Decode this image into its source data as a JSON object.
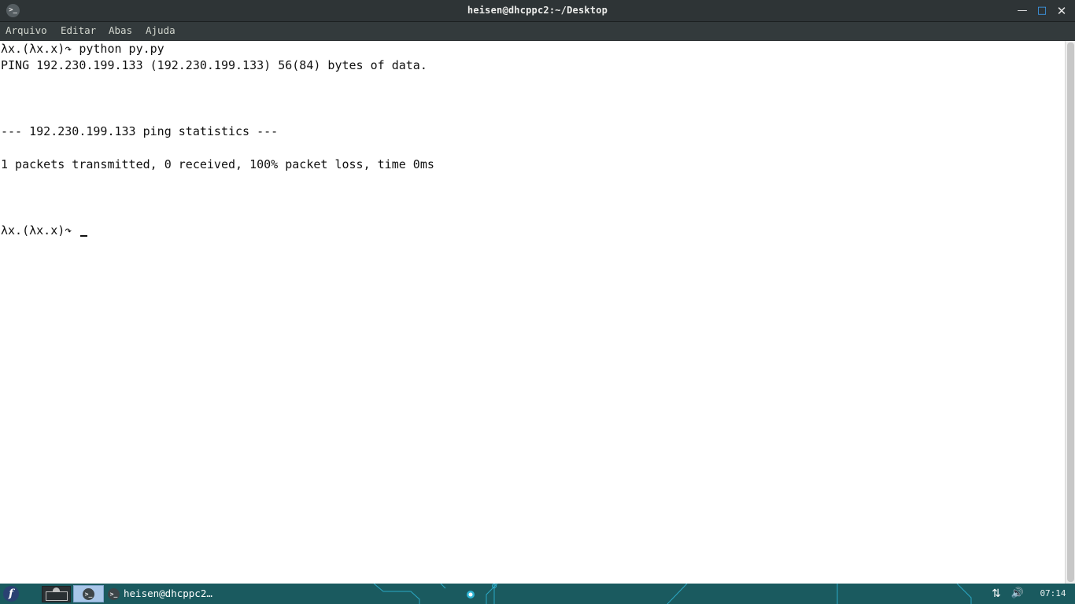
{
  "window": {
    "title": "heisen@dhcppc2:~/Desktop",
    "app_icon_glyph": ">_",
    "controls": {
      "minimize": "—",
      "maximize": "□",
      "close": "✕"
    }
  },
  "menu": {
    "items": [
      "Arquivo",
      "Editar",
      "Abas",
      "Ajuda"
    ]
  },
  "terminal": {
    "prompt": "λx.(λx.x)↷",
    "lines": [
      {
        "prompt": "λx.(λx.x)↷",
        "text": " python py.py"
      },
      {
        "prompt": "",
        "text": "PING 192.230.199.133 (192.230.199.133) 56(84) bytes of data."
      },
      {
        "prompt": "",
        "text": "--- 192.230.199.133 ping statistics ---"
      },
      {
        "prompt": "",
        "text": "1 packets transmitted, 0 received, 100% packet loss, time 0ms"
      },
      {
        "prompt": "λx.(λx.x)↷",
        "text": " "
      }
    ]
  },
  "taskbar": {
    "start_glyph": "f",
    "terminal_glyph": ">_",
    "app_label": "heisen@dhcppc2…",
    "tray": {
      "network_glyph": "⇅",
      "volume_glyph": "🔊"
    },
    "clock": "07:14",
    "colors": {
      "background": "#1a5a5f",
      "pattern": "#2fb6d6"
    }
  }
}
